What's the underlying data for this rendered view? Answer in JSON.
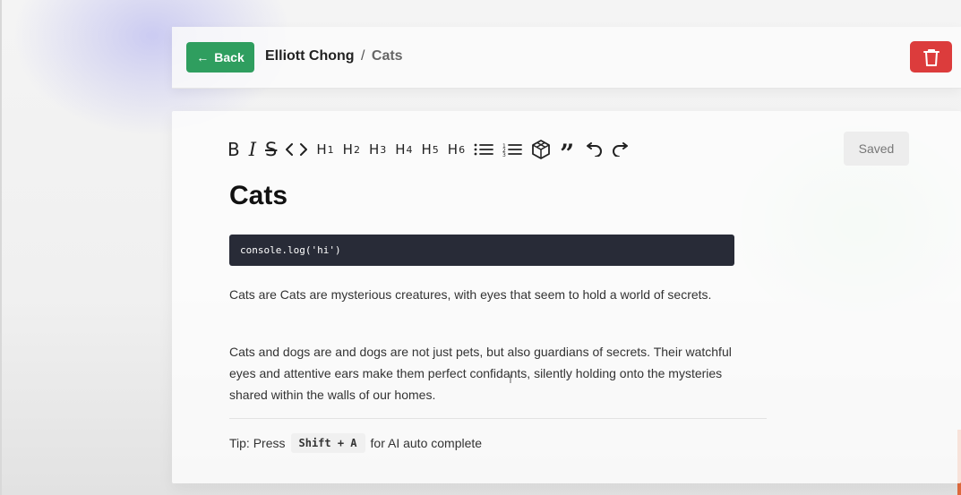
{
  "header": {
    "back_label": "Back",
    "author": "Elliott Chong",
    "separator": "/",
    "current_page": "Cats"
  },
  "toolbar": {
    "items": [
      "bold",
      "italic",
      "strikethrough",
      "code",
      "H1",
      "H2",
      "H3",
      "H4",
      "H5",
      "H6",
      "bullet-list",
      "ordered-list",
      "code-block",
      "blockquote",
      "undo",
      "redo"
    ],
    "saved_label": "Saved"
  },
  "document": {
    "title": "Cats",
    "code": "console.log('hi')",
    "paragraphs": [
      "Cats are Cats are mysterious creatures, with eyes that seem to hold a world of secrets.",
      "Cats and dogs are and dogs are not just pets, but also guardians of secrets. Their watchful eyes and attentive ears make them perfect confidants, silently holding onto the mysteries shared within the walls of our homes."
    ]
  },
  "tip": {
    "prefix": "Tip: Press",
    "shortcut": "Shift + A",
    "suffix": "for AI auto complete"
  },
  "colors": {
    "back_button": "#2f9e5f",
    "delete_button": "#dc3c3c",
    "code_bg": "#282b37"
  }
}
